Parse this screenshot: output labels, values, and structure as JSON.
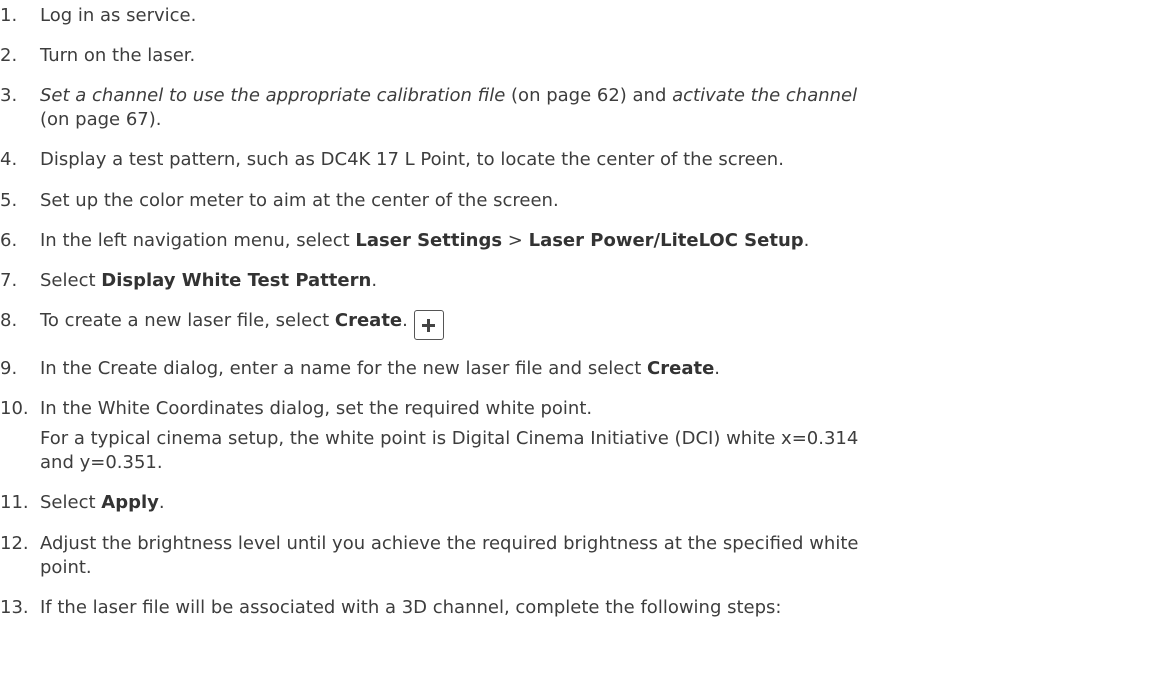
{
  "steps": [
    {
      "n": "1.",
      "text": "Log in as service."
    },
    {
      "n": "2.",
      "text": "Turn on the laser."
    },
    {
      "n": "3.",
      "link1": "Set a channel to use the appropriate calibration file",
      "mid": " (on page 62) and ",
      "link2": "activate the channel",
      "line2": "(on page 67)."
    },
    {
      "n": "4.",
      "text": "Display a test pattern, such as DC4K 17 L Point, to locate the center of the screen."
    },
    {
      "n": "5.",
      "text": "Set up the color meter to aim at the center of the screen."
    },
    {
      "n": "6.",
      "pre": "In the left navigation menu, select ",
      "b1": "Laser Settings",
      "mid": " > ",
      "b2": "Laser Power/LiteLOC Setup",
      "post": "."
    },
    {
      "n": "7.",
      "pre": "Select ",
      "b1": "Display White Test Pattern",
      "post": "."
    },
    {
      "n": "8.",
      "pre": "To create a new laser file, select ",
      "b1": "Create",
      "post": ".",
      "icon": "plus-icon"
    },
    {
      "n": "9.",
      "pre": "In the Create dialog, enter a name for the new laser file and select ",
      "b1": "Create",
      "post": "."
    },
    {
      "n": "10.",
      "text": "In the White Coordinates dialog, set the required white point.",
      "sub1": "For a typical cinema setup, the white point is Digital Cinema Initiative (DCI) white x=0.314",
      "sub2": "and y=0.351."
    },
    {
      "n": "11.",
      "pre": "Select ",
      "b1": "Apply",
      "post": "."
    },
    {
      "n": "12.",
      "text": "Adjust the brightness level until you achieve the required brightness at the specified white",
      "line2": "point."
    },
    {
      "n": "13.",
      "text": "If the laser file will be associated with a 3D channel, complete the following steps:"
    }
  ]
}
